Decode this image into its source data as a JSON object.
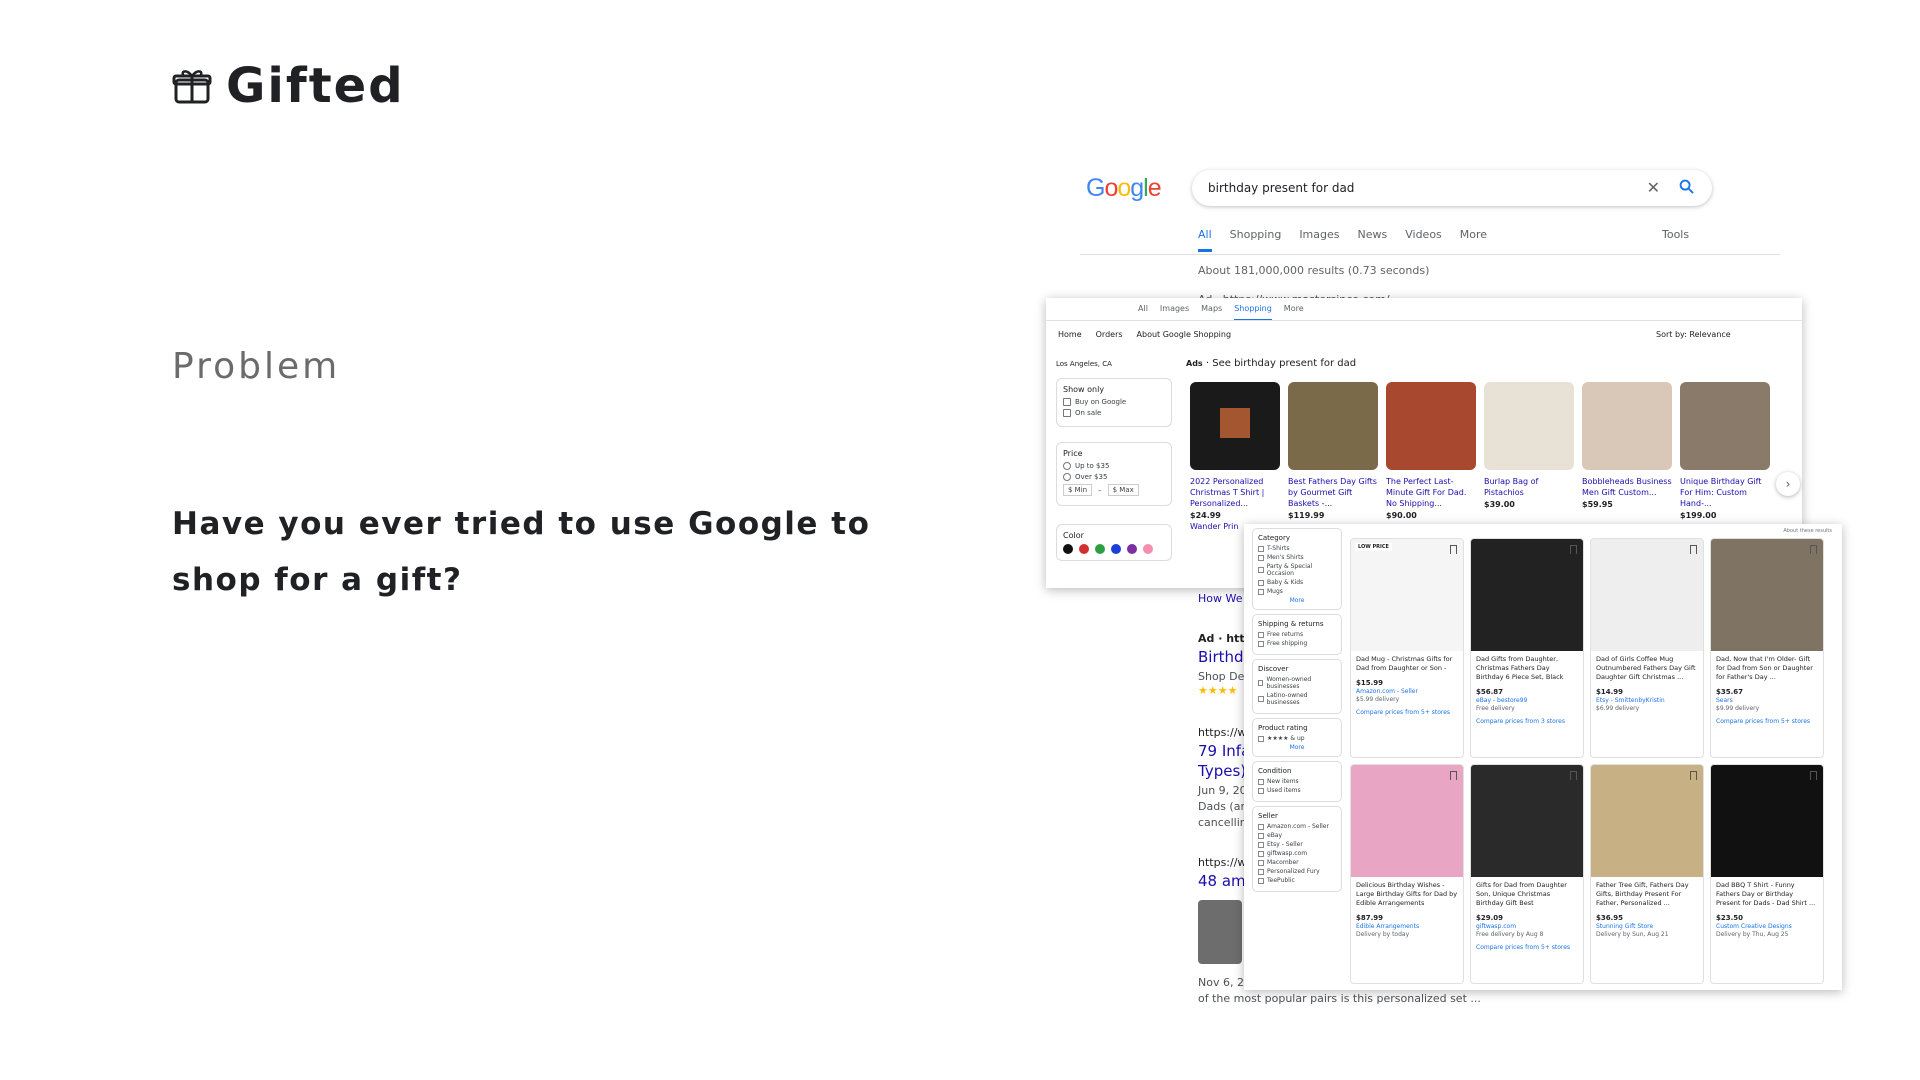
{
  "brand": {
    "name": "Gifted",
    "icon": "gift-icon"
  },
  "section": "Problem",
  "question": "Have you ever tried to use Google to shop for a gift?",
  "google": {
    "logo": "Google",
    "query": "birthday present for dad",
    "tabs": [
      "All",
      "Shopping",
      "Images",
      "News",
      "Videos",
      "More"
    ],
    "tools": "Tools",
    "stats": "About 181,000,000 results (0.73 seconds)",
    "bg": {
      "ad1": "Ad · https://www.mastersinco.com/",
      "how": "How We",
      "ad2": "Ad · http",
      "birth": "Birthda",
      "shop": "Shop Dev",
      "stars": "★★★★",
      "url1": "https://ww",
      "infa": "79 Infa",
      "types": "Types)",
      "jun": "Jun 9, 20",
      "dads": "Dads (an",
      "cancel": "cancelling",
      "url2": "https://ww",
      "ama": "48 ama",
      "nov": "Nov 6, 20",
      "pairs": "of the most popular pairs is this personalized set ..."
    }
  },
  "shopping": {
    "tabs": [
      "All",
      "Images",
      "Maps",
      "Shopping",
      "More"
    ],
    "nav": [
      "Home",
      "Orders",
      "About Google Shopping"
    ],
    "sort": "Sort by: Relevance",
    "location": "Los Angeles, CA",
    "show_only": {
      "title": "Show only",
      "options": [
        "Buy on Google",
        "On sale"
      ]
    },
    "price": {
      "title": "Price",
      "options": [
        "Up to $35",
        "Over $35"
      ],
      "min": "$ Min",
      "max": "$ Max"
    },
    "color": {
      "title": "Color",
      "colors": [
        "#111111",
        "#d32f2f",
        "#2ea043",
        "#1a3fd6",
        "#7b2fa0",
        "#f48fb1"
      ]
    },
    "ads_label": "Ads",
    "ads_title": "See birthday present for dad",
    "products": [
      {
        "title": "2022 Personalized Christmas T Shirt | Personalized...",
        "price": "$24.99",
        "store": "Wander Prin"
      },
      {
        "title": "Best Fathers Day Gifts by Gourmet Gift Baskets -...",
        "price": "$119.99",
        "store": ""
      },
      {
        "title": "The Perfect Last-Minute Gift For Dad. No Shipping...",
        "price": "$90.00",
        "store": ""
      },
      {
        "title": "Burlap Bag of Pistachios",
        "price": "$39.00",
        "store": ""
      },
      {
        "title": "Bobbleheads Business Men Gift Custom...",
        "price": "$59.95",
        "store": ""
      },
      {
        "title": "Unique Birthday Gift For Him: Custom Hand-...",
        "price": "$199.00",
        "store": ""
      }
    ]
  },
  "grid": {
    "about": "About these results",
    "filters": [
      {
        "title": "Category",
        "options": [
          "T-Shirts",
          "Men's Shirts",
          "Party & Special Occasion",
          "Baby & Kids",
          "Mugs"
        ],
        "more": "More"
      },
      {
        "title": "Shipping & returns",
        "options": [
          "Free returns",
          "Free shipping"
        ],
        "more": ""
      },
      {
        "title": "Discover",
        "options": [
          "Women-owned businesses",
          "Latino-owned businesses"
        ],
        "more": ""
      },
      {
        "title": "Product rating",
        "options": [
          "★★★★ & up"
        ],
        "more": "More"
      },
      {
        "title": "Condition",
        "options": [
          "New items",
          "Used items"
        ],
        "more": ""
      },
      {
        "title": "Seller",
        "options": [
          "Amazon.com - Seller",
          "eBay",
          "Etsy - Seller",
          "giftwasp.com",
          "Macomber",
          "Personalized Fury",
          "TeePublic"
        ],
        "more": ""
      }
    ],
    "cards": [
      {
        "badge": "LOW PRICE",
        "title": "Dad Mug - Christmas Gifts for Dad from Daughter or Son -",
        "price": "$15.99",
        "store": "Amazon.com - Seller",
        "delivery": "$5.99 delivery",
        "compare": "Compare prices from 5+ stores"
      },
      {
        "badge": "",
        "title": "Dad Gifts from Daughter, Christmas Fathers Day Birthday 6 Piece Set, Black",
        "price": "$56.87",
        "store": "eBay - bestore99",
        "delivery": "Free delivery",
        "compare": "Compare prices from 3 stores"
      },
      {
        "badge": "",
        "title": "Dad of Girls Coffee Mug Outnumbered Fathers Day Gift Daughter Gift Christmas ...",
        "price": "$14.99",
        "store": "Etsy - SmittenbyKristin",
        "delivery": "$6.99 delivery",
        "compare": ""
      },
      {
        "badge": "",
        "title": "Dad, Now that I'm Older- Gift for Dad from Son or Daughter for Father's Day ...",
        "price": "$35.67",
        "store": "Sears",
        "delivery": "$9.99 delivery",
        "compare": "Compare prices from 5+ stores"
      },
      {
        "badge": "",
        "title": "Delicious Birthday Wishes - Large Birthday Gifts for Dad by Edible Arrangements",
        "price": "$87.99",
        "store": "Edible Arrangements",
        "delivery": "Delivery by today",
        "compare": ""
      },
      {
        "badge": "",
        "title": "Gifts for Dad from Daughter Son, Unique Christmas Birthday Gift Best",
        "price": "$29.09",
        "store": "giftwasp.com",
        "delivery": "Free delivery by Aug 8",
        "compare": "Compare prices from 5+ stores"
      },
      {
        "badge": "",
        "title": "Father Tree Gift, Fathers Day Gifts, Birthday Present For Father, Personalized ...",
        "price": "$36.95",
        "store": "Stunning Gift Store",
        "delivery": "Delivery by Sun, Aug 21",
        "compare": ""
      },
      {
        "badge": "",
        "title": "Dad BBQ T Shirt - Funny Fathers Day or Birthday Present for Dads - Dad Shirt ...",
        "price": "$23.50",
        "store": "Custom Creative Designs",
        "delivery": "Delivery by Thu, Aug 25",
        "compare": ""
      }
    ]
  }
}
